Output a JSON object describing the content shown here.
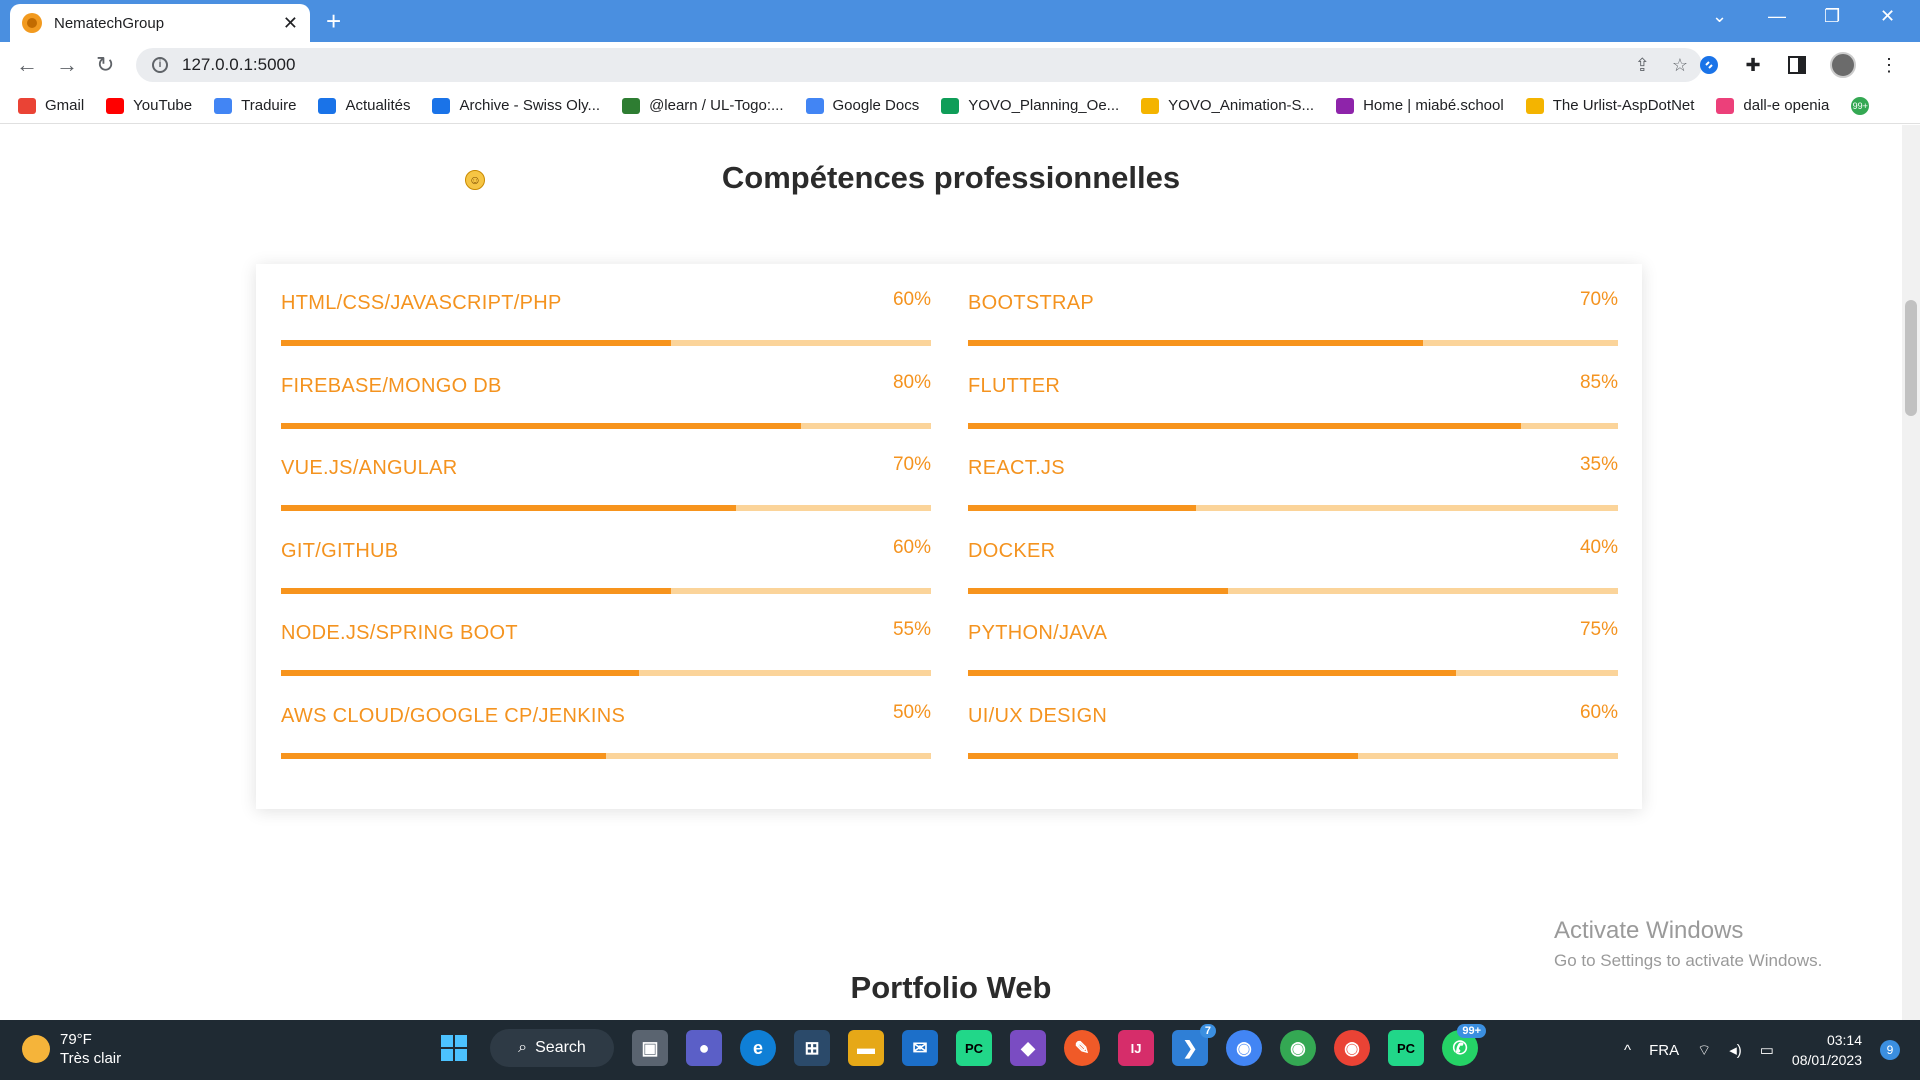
{
  "browser": {
    "tab_title": "NematechGroup",
    "tab_close": "✕",
    "new_tab": "+",
    "url": "127.0.0.1:5000",
    "window_controls": {
      "chevron": "⌄",
      "minimize": "—",
      "restore": "❐",
      "close": "✕"
    }
  },
  "bookmarks": [
    {
      "label": "Gmail",
      "color": "#ea4335"
    },
    {
      "label": "YouTube",
      "color": "#ff0000"
    },
    {
      "label": "Traduire",
      "color": "#4285f4"
    },
    {
      "label": "Actualités",
      "color": "#1a73e8"
    },
    {
      "label": "Archive - Swiss Oly...",
      "color": "#1a73e8"
    },
    {
      "label": "@learn / UL-Togo:...",
      "color": "#2e7d32"
    },
    {
      "label": "Google Docs",
      "color": "#4285f4"
    },
    {
      "label": "YOVO_Planning_Oe...",
      "color": "#0f9d58"
    },
    {
      "label": "YOVO_Animation-S...",
      "color": "#f4b400"
    },
    {
      "label": "Home | miabé.school",
      "color": "#8e24aa"
    },
    {
      "label": "The Urlist-AspDotNet",
      "color": "#f4b400"
    },
    {
      "label": "dall-e openia",
      "color": "#ec407a"
    }
  ],
  "bookmark_more_badge": "99+",
  "page": {
    "skills_title": "Compétences professionnelles",
    "portfolio_title": "Portfolio Web",
    "skills": [
      {
        "name": "HTML/CSS/JAVASCRIPT/PHP",
        "value": "60%",
        "percent": 60
      },
      {
        "name": "BOOTSTRAP",
        "value": "70%",
        "percent": 70
      },
      {
        "name": "FIREBASE/MONGO DB",
        "value": "80%",
        "percent": 80
      },
      {
        "name": "FLUTTER",
        "value": "85%",
        "percent": 85
      },
      {
        "name": "VUE.JS/ANGULAR",
        "value": "70%",
        "percent": 70
      },
      {
        "name": "REACT.JS",
        "value": "35%",
        "percent": 35
      },
      {
        "name": "GIT/GITHUB",
        "value": "60%",
        "percent": 60
      },
      {
        "name": "DOCKER",
        "value": "40%",
        "percent": 40
      },
      {
        "name": "NODE.JS/SPRING BOOT",
        "value": "55%",
        "percent": 55
      },
      {
        "name": "PYTHON/JAVA",
        "value": "75%",
        "percent": 75
      },
      {
        "name": "AWS CLOUD/GOOGLE CP/JENKINS",
        "value": "50%",
        "percent": 50
      },
      {
        "name": "UI/UX DESIGN",
        "value": "60%",
        "percent": 60
      }
    ],
    "accent_color": "#f7941d",
    "track_color": "#fbd49a"
  },
  "watermark": {
    "title": "Activate Windows",
    "subtitle": "Go to Settings to activate Windows."
  },
  "taskbar": {
    "temperature": "79°F",
    "weather": "Très clair",
    "search_label": "Search",
    "language": "FRA",
    "time": "03:14",
    "date": "08/01/2023",
    "notification_count": "9",
    "badges": {
      "pycharm_updates": "7",
      "whatsapp": "99+"
    }
  }
}
